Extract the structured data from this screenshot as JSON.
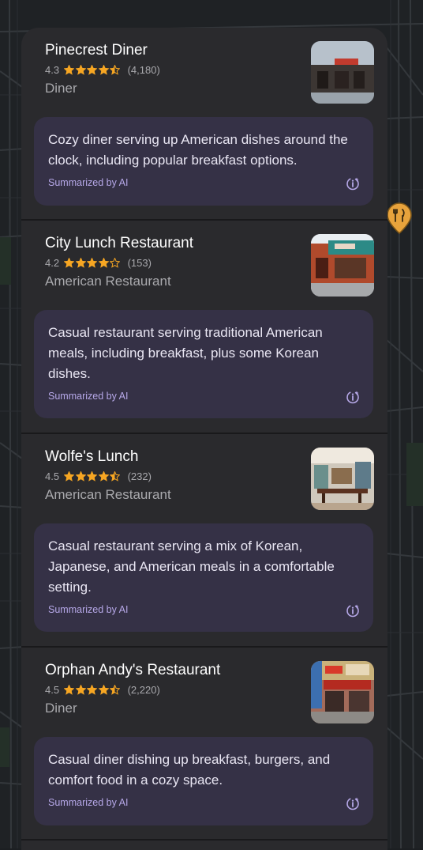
{
  "colors": {
    "star": "#f6a623",
    "summary_bg": "#353146",
    "ai_label": "#b6a8e8",
    "pin": "#e8a33c"
  },
  "places": [
    {
      "name": "Pinecrest Diner",
      "rating": "4.3",
      "stars": 4.5,
      "reviews": "(4,180)",
      "category": "Diner",
      "summary": "Cozy diner serving up American dishes around the clock, including popular breakfast options.",
      "ai_label": "Summarized by AI"
    },
    {
      "name": "City Lunch Restaurant",
      "rating": "4.2",
      "stars": 4,
      "reviews": "(153)",
      "category": "American Restaurant",
      "summary": "Casual restaurant serving traditional American meals, including breakfast, plus some Korean dishes.",
      "ai_label": "Summarized by AI"
    },
    {
      "name": "Wolfe's Lunch",
      "rating": "4.5",
      "stars": 4.5,
      "reviews": "(232)",
      "category": "American Restaurant",
      "summary": "Casual restaurant serving a mix of Korean, Japanese, and American meals in a comfortable setting.",
      "ai_label": "Summarized by AI"
    },
    {
      "name": "Orphan Andy's Restaurant",
      "rating": "4.5",
      "stars": 4.5,
      "reviews": "(2,220)",
      "category": "Diner",
      "summary": "Casual diner dishing up breakfast, burgers, and comfort food in a cozy space.",
      "ai_label": "Summarized by AI"
    }
  ],
  "icons": {
    "ai": "ai-info-icon",
    "pin": "restaurant-pin-icon",
    "star_full": "star-icon",
    "star_half": "star-half-icon",
    "star_empty": "star-outline-icon"
  }
}
